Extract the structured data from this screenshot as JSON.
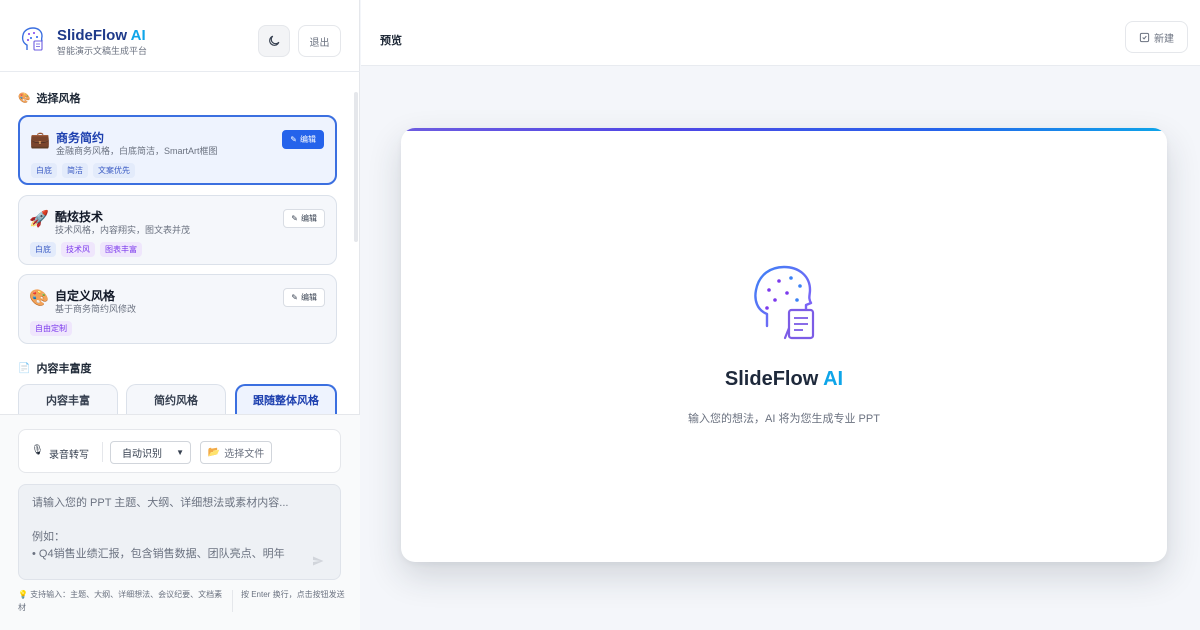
{
  "colors": {
    "accent": "#2563eb",
    "brand": "#1e3a8a",
    "ai_accent": "#0ea5e9",
    "tag_purple": "#7c3aed"
  },
  "brand": {
    "name": "SlideFlow",
    "ai": "AI",
    "subtitle": "智能演示文稿生成平台"
  },
  "header": {
    "theme_icon": "moon-icon",
    "logout_label": "退出"
  },
  "styles_section": {
    "title": "选择风格",
    "icon": "palette-icon",
    "cards": [
      {
        "icon": "briefcase-icon",
        "emoji": "💼",
        "name": "商务简约",
        "desc": "金融商务风格，白底简洁，SmartArt框图",
        "edit_label": "编辑",
        "tags": [
          "白底",
          "简洁",
          "文案优先"
        ],
        "active": true
      },
      {
        "icon": "rocket-icon",
        "emoji": "🚀",
        "name": "酷炫技术",
        "desc": "技术风格，内容翔实，图文表并茂",
        "edit_label": "编辑",
        "tags": [
          "白底",
          "技术风",
          "图表丰富"
        ],
        "active": false
      },
      {
        "icon": "palette-icon",
        "emoji": "🎨",
        "name": "自定义风格",
        "desc": "基于商务简约风修改",
        "edit_label": "编辑",
        "tags": [
          "自由定制"
        ],
        "active": false
      }
    ]
  },
  "richness_section": {
    "title": "内容丰富度",
    "icon": "document-icon",
    "options": [
      "内容丰富",
      "简约风格",
      "跟随整体风格"
    ],
    "selected_index": 2
  },
  "input_panel": {
    "mic_label": "录音转写",
    "language_select": "自动识别",
    "file_button": "选择文件",
    "placeholder": "请输入您的 PPT 主题、大纲、详细想法或素材内容...\n\n例如：\n• Q4销售业绩汇报，包含销售数据、团队亮点、明年",
    "send_icon": "send-icon",
    "hint_left": "💡 支持输入：主题、大纲、详细想法、会议纪要、文档素材",
    "hint_right": "按 Enter 换行，点击按钮发送"
  },
  "main": {
    "preview_title": "预览",
    "new_button": "新建",
    "center_title_main": "SlideFlow",
    "center_title_ai": "AI",
    "center_subtitle": "输入您的想法，AI 将为您生成专业 PPT"
  }
}
